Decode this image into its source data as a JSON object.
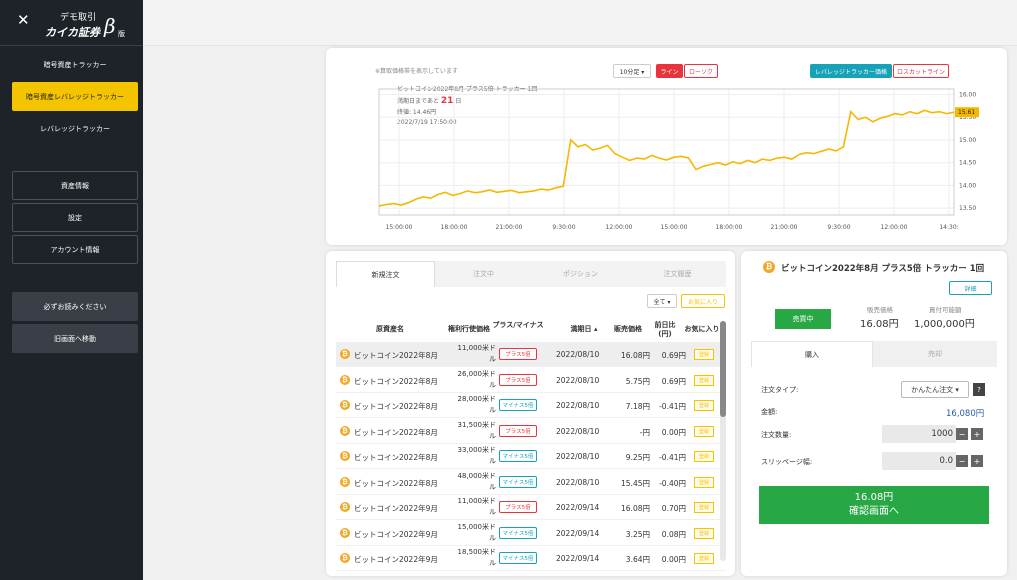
{
  "sidebar": {
    "logo_top": "デモ取引",
    "logo_main": "カイカ証券",
    "logo_beta": "β",
    "logo_ban": "版",
    "items": [
      {
        "label": "暗号資産トラッカー"
      },
      {
        "label": "暗号資産レバレッジトラッカー"
      },
      {
        "label": "レバレッジトラッカー"
      },
      {
        "label": "資産情報"
      },
      {
        "label": "設定"
      },
      {
        "label": "アカウント情報"
      },
      {
        "label": "必ずお読みください"
      },
      {
        "label": "旧画面へ移動"
      }
    ]
  },
  "chart_panel": {
    "hint": "※算取価格帯を表示しています",
    "interval": "10分足 ▾",
    "line_btn": "ライン",
    "candle_btn": "ローソク",
    "lev_price_btn": "レバレッジトラッカー価格",
    "losscut_btn": "ロスカットライン",
    "info_title": "ビットコイン2022年8月 プラス5倍 トラッカー 1回",
    "info_days_prefix": "満期日まであと",
    "info_days": "21",
    "info_days_suffix": "日",
    "info_close": "終値: 14.46円",
    "info_time": "2022/7/19 17:50:00",
    "current_price": "15.61"
  },
  "chart_data": {
    "type": "line",
    "x_ticks": [
      "15:00:00",
      "18:00:00",
      "21:00:00",
      "9:30:00",
      "12:00:00",
      "15:00:00",
      "18:00:00",
      "21:00:00",
      "9:30:00",
      "12:00:00",
      "14:30:"
    ],
    "y_ticks": [
      "16.00",
      "15.50",
      "15.00",
      "14.50",
      "14.00",
      "13.50"
    ],
    "ylim": [
      13.35,
      16.12
    ],
    "line_color": "#f5b800",
    "series": [
      {
        "values": [
          13.55,
          13.58,
          13.6,
          13.57,
          13.62,
          13.7,
          13.75,
          13.72,
          13.8,
          13.85,
          13.78,
          13.82,
          13.88,
          13.84,
          13.86,
          13.9,
          13.85,
          13.87,
          13.89,
          13.84,
          13.86,
          13.88,
          13.92,
          13.9,
          13.95,
          13.98,
          15.0,
          14.85,
          14.9,
          14.78,
          14.82,
          14.88,
          14.7,
          14.62,
          14.55,
          14.6,
          14.58,
          14.66,
          14.6,
          14.56,
          14.62,
          14.64,
          14.6,
          14.35,
          14.42,
          14.46,
          14.5,
          14.45,
          14.52,
          14.48,
          14.55,
          14.5,
          14.58,
          14.55,
          14.6,
          14.62,
          14.58,
          14.68,
          14.72,
          14.7,
          14.75,
          14.8,
          14.76,
          14.85,
          15.62,
          15.45,
          15.5,
          15.4,
          15.48,
          15.52,
          15.58,
          15.55,
          15.62,
          15.58,
          15.65,
          15.6,
          15.62,
          15.58,
          15.61
        ]
      }
    ]
  },
  "order_panel": {
    "tabs": [
      "新規注文",
      "注文中",
      "ポジション",
      "注文履歴"
    ],
    "filter_all": "全て ▾",
    "filter_fav": "お気に入り",
    "headers": [
      "原資産名",
      "権利行使価格",
      "プラス/マイナス",
      "満期日 ▴",
      "販売価格",
      "前日比(円)",
      "お気に入り"
    ],
    "fav_label": "登録",
    "rows": [
      {
        "name": "ビットコイン2022年8月",
        "strike": "11,000米ドル",
        "type": "プラス5倍",
        "kind": "plus",
        "expiry": "2022/08/10",
        "price": "16.08円",
        "change": "0.69円"
      },
      {
        "name": "ビットコイン2022年8月",
        "strike": "26,000米ドル",
        "type": "プラス5倍",
        "kind": "plus",
        "expiry": "2022/08/10",
        "price": "5.75円",
        "change": "0.69円"
      },
      {
        "name": "ビットコイン2022年8月",
        "strike": "28,000米ドル",
        "type": "マイナス5倍",
        "kind": "minus",
        "expiry": "2022/08/10",
        "price": "7.18円",
        "change": "-0.41円"
      },
      {
        "name": "ビットコイン2022年8月",
        "strike": "31,500米ドル",
        "type": "プラス5倍",
        "kind": "plus",
        "expiry": "2022/08/10",
        "price": "-円",
        "change": "0.00円"
      },
      {
        "name": "ビットコイン2022年8月",
        "strike": "33,000米ドル",
        "type": "マイナス5倍",
        "kind": "minus",
        "expiry": "2022/08/10",
        "price": "9.25円",
        "change": "-0.41円"
      },
      {
        "name": "ビットコイン2022年8月",
        "strike": "48,000米ドル",
        "type": "マイナス5倍",
        "kind": "minus",
        "expiry": "2022/08/10",
        "price": "15.45円",
        "change": "-0.40円"
      },
      {
        "name": "ビットコイン2022年9月",
        "strike": "11,000米ドル",
        "type": "プラス5倍",
        "kind": "plus",
        "expiry": "2022/09/14",
        "price": "16.08円",
        "change": "0.70円"
      },
      {
        "name": "ビットコイン2022年9月",
        "strike": "15,000米ドル",
        "type": "マイナス5倍",
        "kind": "minus",
        "expiry": "2022/09/14",
        "price": "3.25円",
        "change": "0.08円"
      },
      {
        "name": "ビットコイン2022年9月",
        "strike": "18,500米ドル",
        "type": "マイナス5倍",
        "kind": "minus",
        "expiry": "2022/09/14",
        "price": "3.64円",
        "change": "0.00円"
      }
    ]
  },
  "detail_panel": {
    "title": "ビットコイン2022年8月 プラス5倍 トラッカー 1回",
    "detail_btn": "詳細",
    "status": "売買中",
    "sell_price_label": "販売価格",
    "sell_price": "16.08円",
    "buy_power_label": "買付可能額",
    "buy_power": "1,000,000円",
    "tab_buy": "購入",
    "tab_sell": "売却",
    "order_type_label": "注文タイプ:",
    "order_type_value": "かんたん注文 ▾",
    "help": "?",
    "amount_label": "金額:",
    "amount_value": "16,080円",
    "qty_label": "注文数量:",
    "qty_value": "1000",
    "slip_label": "スリッページ幅:",
    "slip_value": "0.0",
    "minus": "−",
    "plus": "+",
    "confirm_price": "16.08円",
    "confirm_text": "確認画面へ"
  }
}
